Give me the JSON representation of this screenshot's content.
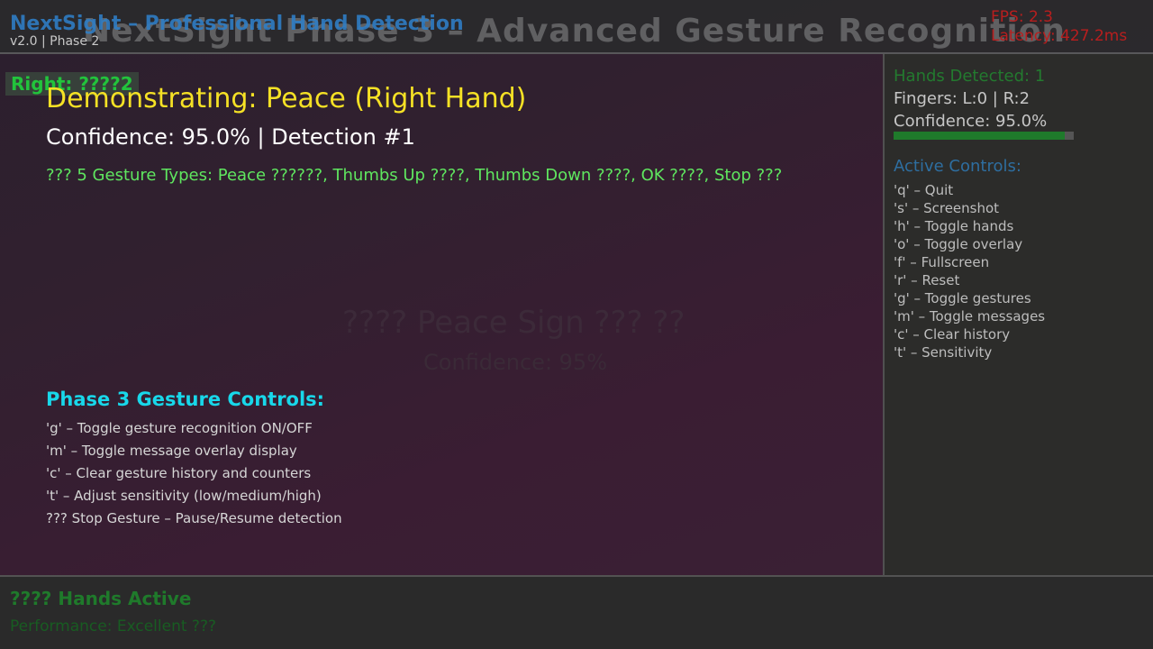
{
  "header": {
    "background_title": "NextSight Phase 3 – Advanced Gesture Recognition",
    "app_title": "NextSight – Professional Hand Detection",
    "version": "v2.0 | Phase 2",
    "fps": "FPS: 2.3",
    "latency": "Latency: 427.2ms"
  },
  "overlay": {
    "hand_tag": "Right: ????2",
    "gesture_demo": "Demonstrating: Peace (Right Hand)",
    "confidence_line": "Confidence: 95.0% | Detection #1",
    "gesture_types": "??? 5 Gesture Types: Peace ??????, Thumbs Up ????, Thumbs Down ????, OK ????, Stop ???",
    "faint_message": "???? Peace Sign ??? ??",
    "faint_sub": "Confidence: 95%",
    "controls_title": "Phase 3 Gesture Controls:",
    "controls": [
      "'g' – Toggle gesture recognition ON/OFF",
      "'m' – Toggle message overlay display",
      "'c' – Clear gesture history and counters",
      "'t' – Adjust sensitivity (low/medium/high)",
      "??? Stop Gesture – Pause/Resume detection"
    ]
  },
  "sidebar": {
    "hands_detected": "Hands Detected: 1",
    "fingers": "Fingers: L:0 | R:2",
    "confidence": "Confidence: 95.0%",
    "confidence_value": 0.95,
    "active_controls_title": "Active Controls:",
    "controls": [
      "'q' – Quit",
      "'s' – Screenshot",
      "'h' – Toggle hands",
      "'o' – Toggle overlay",
      "'f' – Fullscreen",
      "'r' – Reset",
      "'g' – Toggle gestures",
      "'m' – Toggle messages",
      "'c' – Clear history",
      "'t' – Sensitivity"
    ]
  },
  "footer": {
    "hands_active": "???? Hands Active",
    "performance": "Performance: Excellent ???"
  }
}
